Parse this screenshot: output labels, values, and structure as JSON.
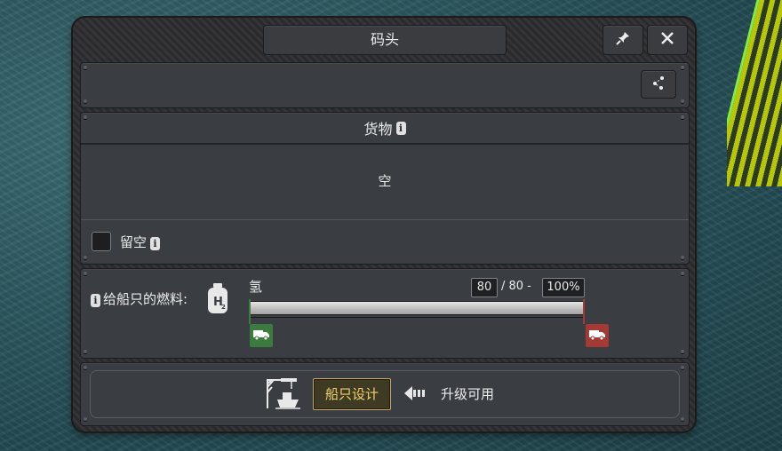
{
  "window": {
    "title": "码头"
  },
  "cargo": {
    "header": "货物",
    "empty_text": "空"
  },
  "keep_empty": {
    "label": "留空"
  },
  "fuel": {
    "label": "给船只的燃料:",
    "fuel_name": "氢",
    "current": "80",
    "separator": "/ 80 -",
    "percent": "100%",
    "fill_fraction": 1.0
  },
  "footer": {
    "design_button": "船只设计",
    "upgrade_text": "升级可用"
  },
  "icons": {
    "pin": "pin-icon",
    "close": "close-icon",
    "network": "network-icon",
    "info": "info-icon",
    "hydrogen_tank": "hydrogen-tank-icon",
    "truck_green": "truck-icon",
    "truck_red": "truck-icon",
    "shipyard": "shipyard-icon",
    "arrow_left": "arrow-left-icon"
  },
  "colors": {
    "green_marker": "#3c7b3f",
    "red_marker": "#a33a34",
    "gold": "#f2d36a"
  }
}
